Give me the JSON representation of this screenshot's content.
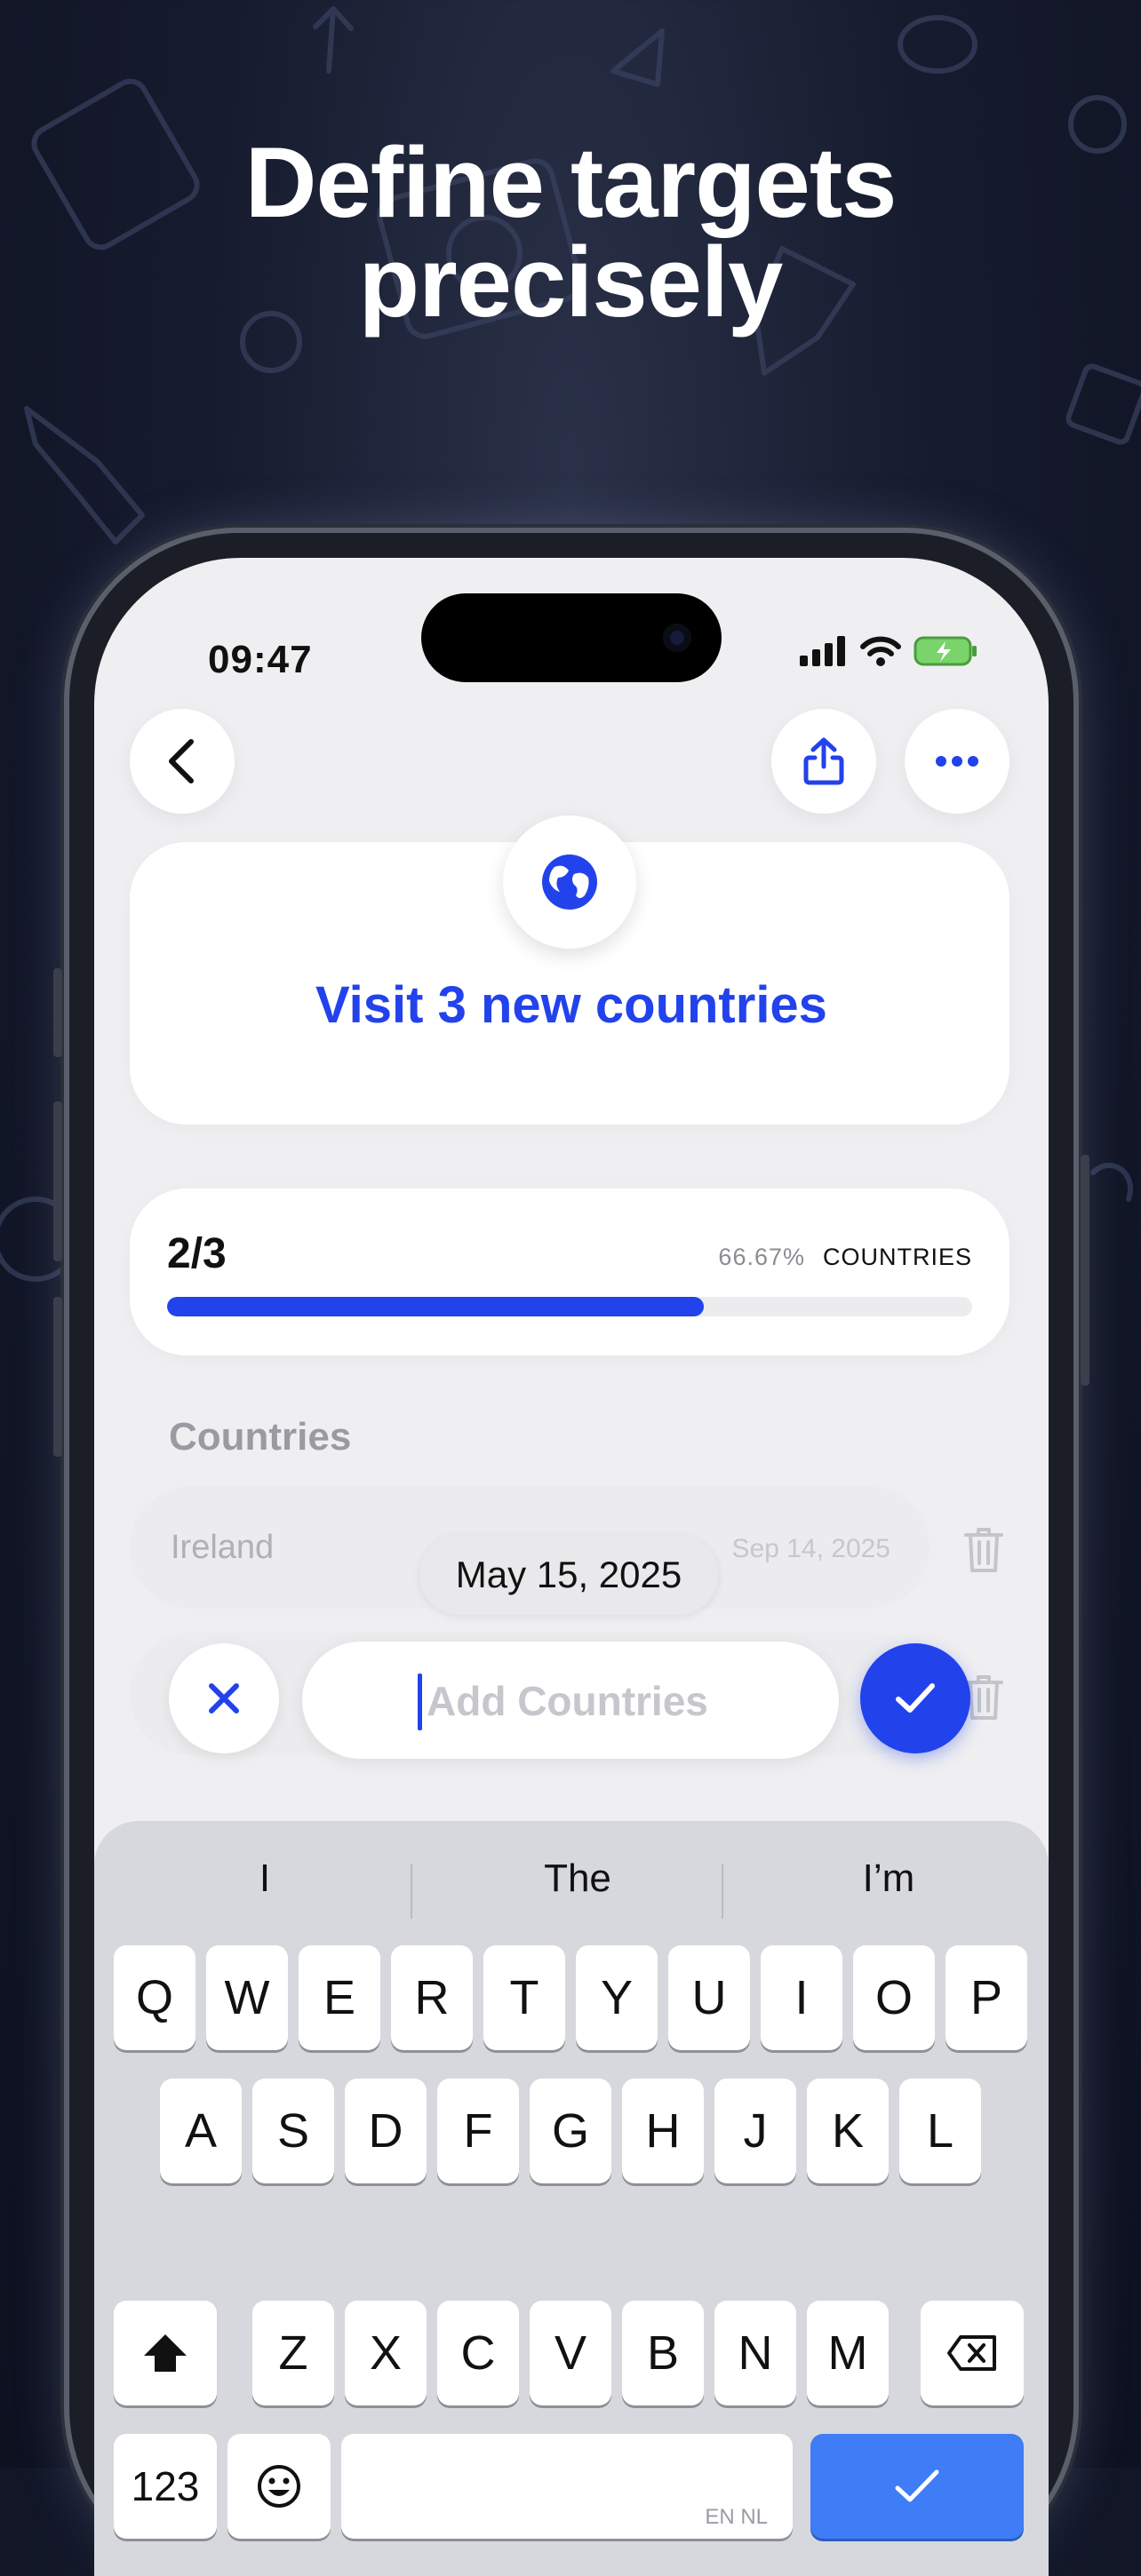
{
  "headline": {
    "line1": "Define targets",
    "line2": "precisely"
  },
  "status_bar": {
    "time": "09:47"
  },
  "goal": {
    "title": "Visit 3 new countries",
    "icon": "globe-icon"
  },
  "progress": {
    "fraction": "2/3",
    "percent_label": "66.67%",
    "unit": "COUNTRIES",
    "value": 0.6667
  },
  "section": {
    "title": "Countries"
  },
  "countries": [
    {
      "name": "Ireland",
      "date": "Sep 14, 2025"
    },
    {
      "name": "",
      "date": ""
    }
  ],
  "date_picker": {
    "value": "May 15, 2025"
  },
  "input": {
    "placeholder": "Add Countries",
    "value": ""
  },
  "keyboard": {
    "suggestions": [
      "I",
      "The",
      "I’m"
    ],
    "row1": [
      "Q",
      "W",
      "E",
      "R",
      "T",
      "Y",
      "U",
      "I",
      "O",
      "P"
    ],
    "row2": [
      "A",
      "S",
      "D",
      "F",
      "G",
      "H",
      "J",
      "K",
      "L"
    ],
    "row3": [
      "Z",
      "X",
      "C",
      "V",
      "B",
      "N",
      "M"
    ],
    "numbers_key": "123",
    "language": "EN NL"
  },
  "colors": {
    "accent": "#2242ec",
    "keyboard_return": "#3e7df6"
  }
}
